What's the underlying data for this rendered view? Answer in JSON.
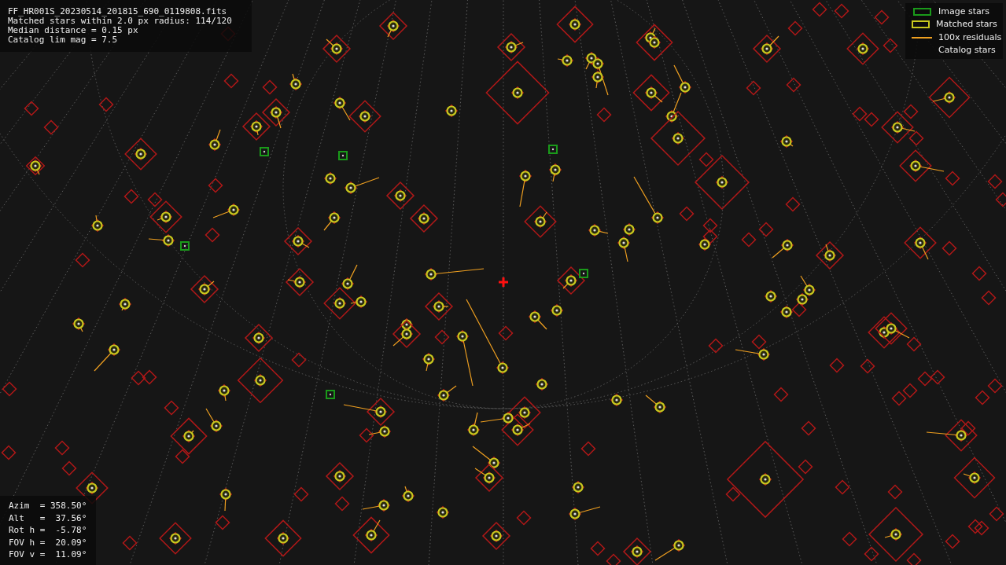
{
  "header": [
    "FF_HR001S_20230514_201815_690_0119808.fits",
    "Matched stars within 2.0 px radius: 114/120",
    "Median distance = 0.15 px",
    "Catalog lim mag = 7.5"
  ],
  "legend": [
    {
      "label": "Image stars",
      "kind": "image"
    },
    {
      "label": "Matched stars",
      "kind": "matched"
    },
    {
      "label": "100x residuals",
      "kind": "residual"
    },
    {
      "label": "Catalog stars",
      "kind": "catalog"
    }
  ],
  "pointing": [
    "Azim  = 358.50°",
    "Alt   =  37.56°",
    "Rot h =  -5.78°",
    "FOV h =  20.09°",
    "FOV v =  11.09°"
  ]
}
